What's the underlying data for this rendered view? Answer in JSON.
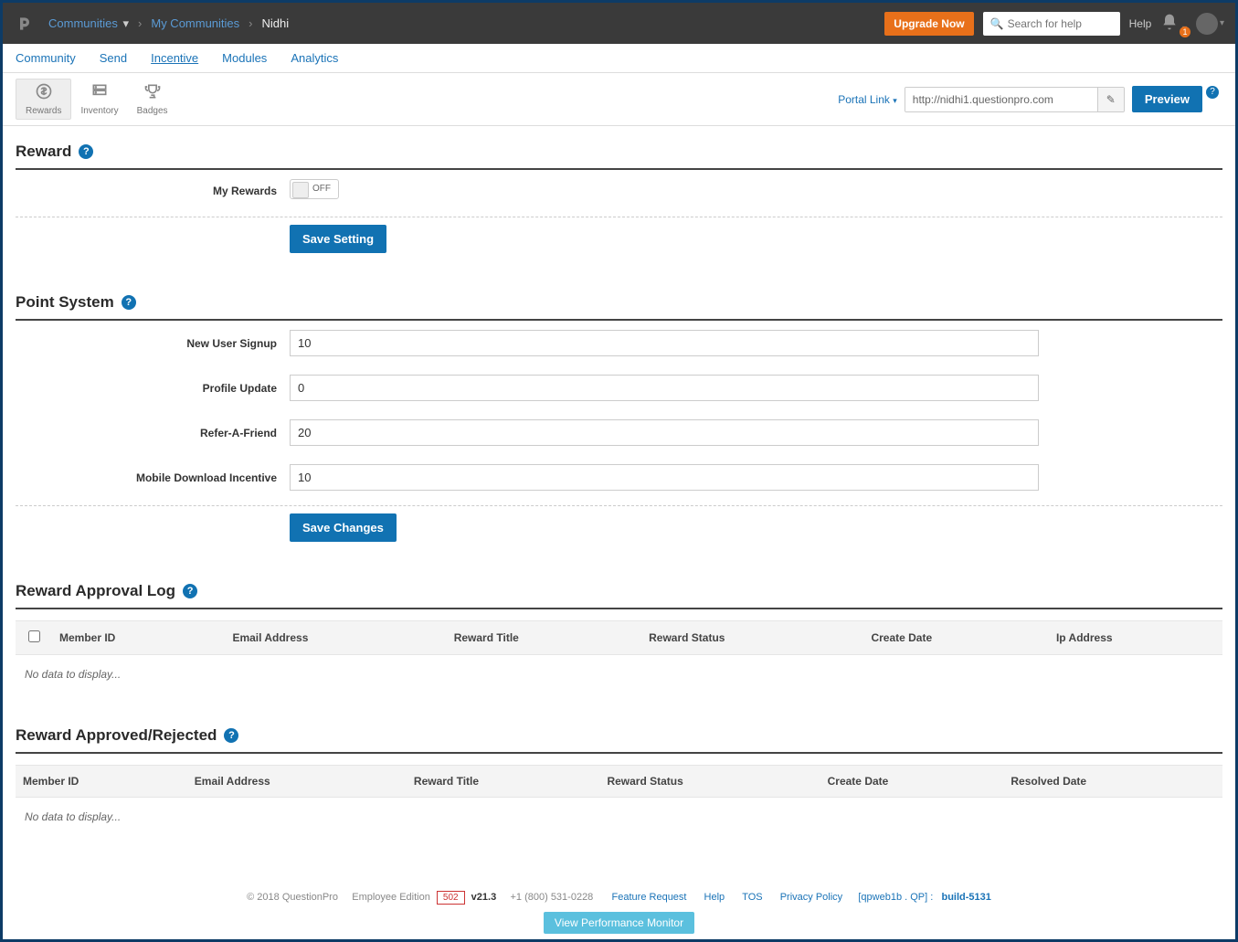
{
  "header": {
    "breadcrumbs": {
      "root": "Communities",
      "level1": "My Communities",
      "current": "Nidhi"
    },
    "upgrade_label": "Upgrade Now",
    "search_placeholder": "Search for help",
    "help_label": "Help",
    "notification_count": "1"
  },
  "main_nav": {
    "community": "Community",
    "send": "Send",
    "incentive": "Incentive",
    "modules": "Modules",
    "analytics": "Analytics"
  },
  "subnav": {
    "rewards": "Rewards",
    "inventory": "Inventory",
    "badges": "Badges",
    "portal_link_label": "Portal Link",
    "portal_url": "http://nidhi1.questionpro.com",
    "preview_label": "Preview"
  },
  "sections": {
    "reward": {
      "title": "Reward",
      "my_rewards_label": "My Rewards",
      "toggle_state": "OFF",
      "save_label": "Save Setting"
    },
    "point_system": {
      "title": "Point System",
      "fields": {
        "new_user_signup": {
          "label": "New User Signup",
          "value": "10"
        },
        "profile_update": {
          "label": "Profile Update",
          "value": "0"
        },
        "refer_a_friend": {
          "label": "Refer-A-Friend",
          "value": "20"
        },
        "mobile_download": {
          "label": "Mobile Download Incentive",
          "value": "10"
        }
      },
      "save_label": "Save Changes"
    },
    "approval_log": {
      "title": "Reward Approval Log",
      "columns": {
        "member_id": "Member ID",
        "email": "Email Address",
        "reward_title": "Reward Title",
        "reward_status": "Reward Status",
        "create_date": "Create Date",
        "ip_address": "Ip Address"
      },
      "no_data": "No data to display..."
    },
    "approved_rejected": {
      "title": "Reward Approved/Rejected",
      "columns": {
        "member_id": "Member ID",
        "email": "Email Address",
        "reward_title": "Reward Title",
        "reward_status": "Reward Status",
        "create_date": "Create Date",
        "resolved_date": "Resolved Date"
      },
      "no_data": "No data to display..."
    }
  },
  "footer": {
    "copyright": "© 2018 QuestionPro",
    "edition": "Employee Edition",
    "code": "502",
    "version": "v21.3",
    "phone": "+1 (800) 531-0228",
    "feature_request": "Feature Request",
    "help": "Help",
    "tos": "TOS",
    "privacy": "Privacy Policy",
    "server": "[qpweb1b . QP] :",
    "build": "build-5131",
    "perf_monitor": "View Performance Monitor"
  }
}
